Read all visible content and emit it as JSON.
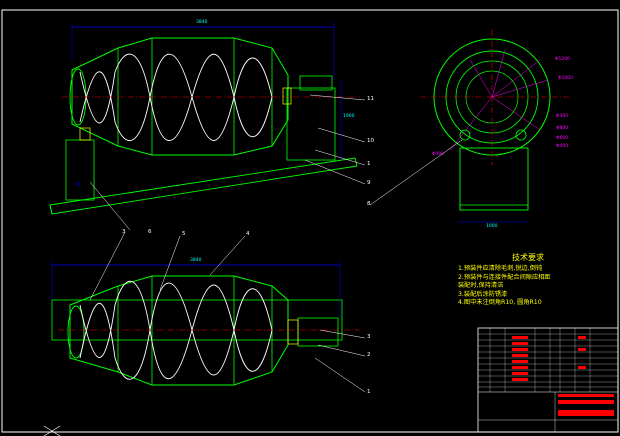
{
  "tech_notes": {
    "title": "技术要求",
    "lines": [
      "1.预装件应清除毛刺,锐边,倒钝",
      "2.预装件与连接件配合间隙应相距",
      "  装配时,保持清洁",
      "3.装配后涂防锈漆",
      "4.图中未注倒角R10, 圆角R10"
    ]
  },
  "part_labels": {
    "top_view": [
      "11",
      "10",
      "1",
      "9",
      "8",
      "6"
    ],
    "bottom_view": [
      "3",
      "5",
      "4",
      "3",
      "2",
      "1"
    ]
  },
  "dimensions": {
    "top_length": "3840",
    "bottom_length": "3840",
    "end_width": "1000",
    "height": "1900"
  },
  "end_view_labels": [
    "Φ1200",
    "Φ1000",
    "Φ800",
    "Φ600",
    "Φ400",
    "Φ300",
    "Φ300"
  ],
  "colors": {
    "background": "#000000",
    "outline": "#00ff00",
    "helix": "#ffffff",
    "center": "#ff0000",
    "dimension": "#0000ff",
    "notes": "#ffff00"
  }
}
